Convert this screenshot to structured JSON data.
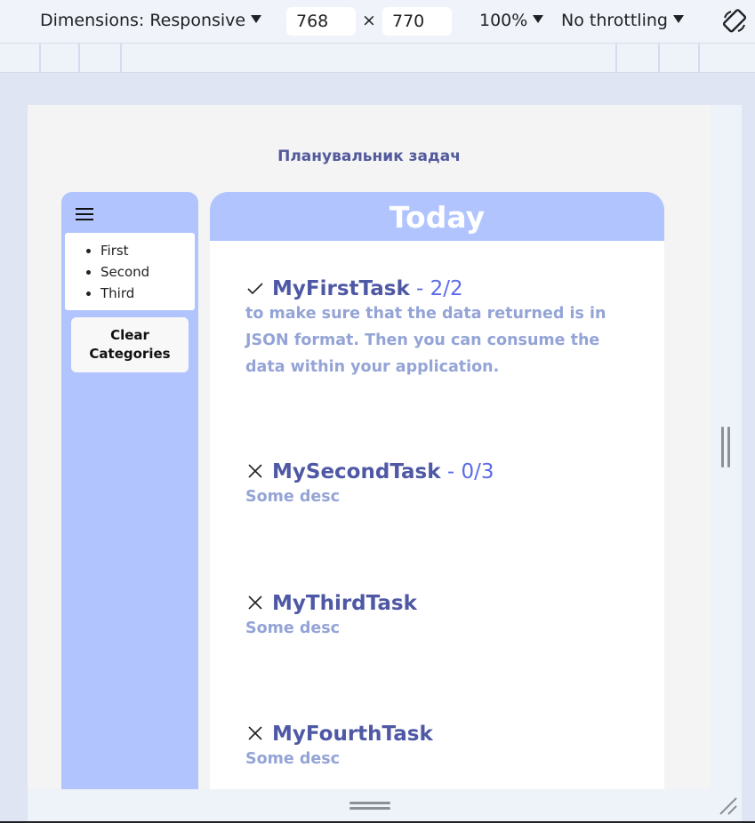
{
  "devtools": {
    "dimensions_label": "Dimensions: Responsive",
    "width": "768",
    "height": "770",
    "times": "×",
    "zoom": "100%",
    "throttling": "No throttling"
  },
  "app": {
    "title": "Планувальник задач",
    "sidebar": {
      "categories": [
        "First",
        "Second",
        "Third"
      ],
      "clear_button": "Clear Categories"
    },
    "panel_title": "Today",
    "tasks": [
      {
        "name": "MyFirstTask",
        "progress": " - 2/2",
        "done": true,
        "desc": "to make sure that the data returned is in JSON format. Then you can consume the data within your application."
      },
      {
        "name": "MySecondTask",
        "progress": " - 0/3",
        "done": false,
        "desc": "Some desc"
      },
      {
        "name": "MyThirdTask",
        "progress": "",
        "done": false,
        "desc": "Some desc"
      },
      {
        "name": "MyFourthTask",
        "progress": "",
        "done": false,
        "desc": "Some desc"
      }
    ]
  }
}
